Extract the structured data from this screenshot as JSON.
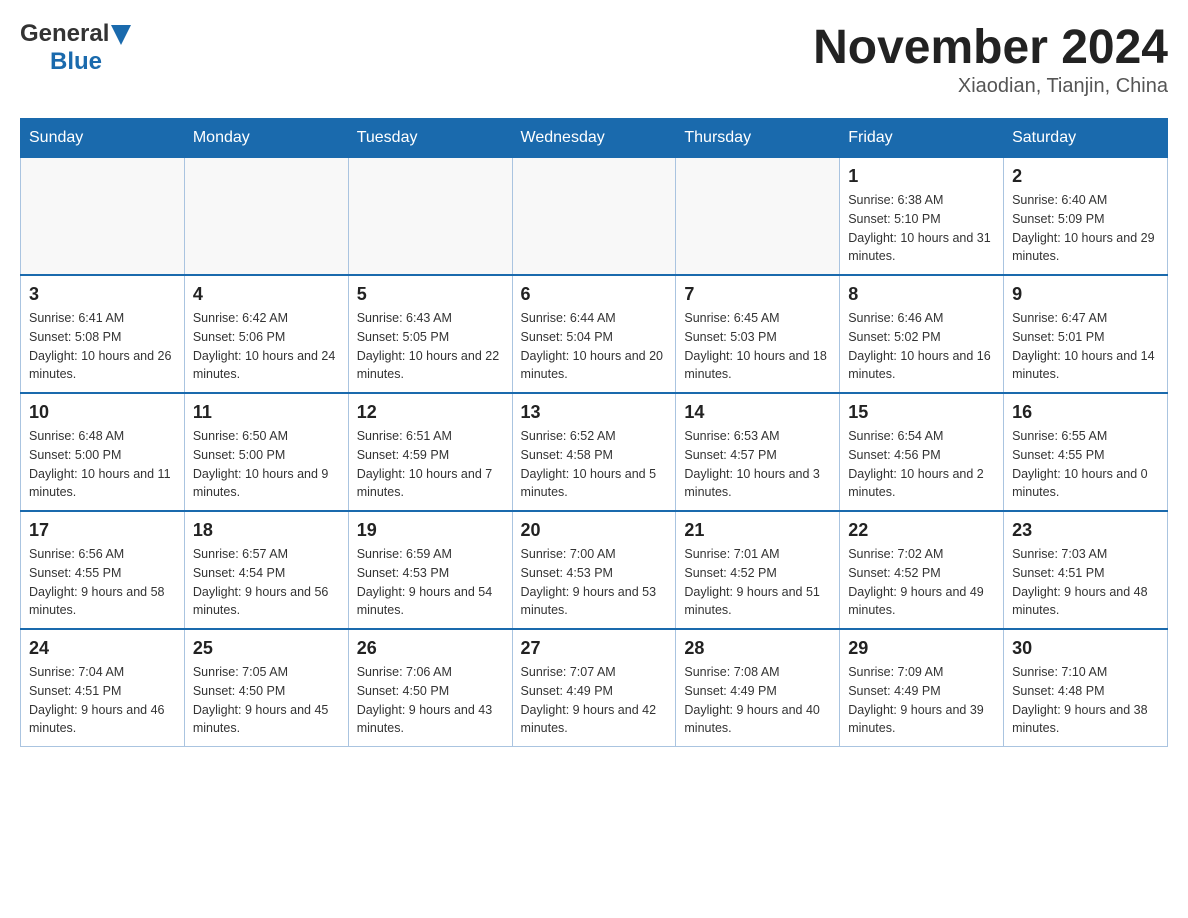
{
  "header": {
    "logo_general": "General",
    "logo_blue": "Blue",
    "title": "November 2024",
    "location": "Xiaodian, Tianjin, China"
  },
  "days_of_week": [
    "Sunday",
    "Monday",
    "Tuesday",
    "Wednesday",
    "Thursday",
    "Friday",
    "Saturday"
  ],
  "weeks": [
    [
      {
        "day": "",
        "info": ""
      },
      {
        "day": "",
        "info": ""
      },
      {
        "day": "",
        "info": ""
      },
      {
        "day": "",
        "info": ""
      },
      {
        "day": "",
        "info": ""
      },
      {
        "day": "1",
        "info": "Sunrise: 6:38 AM\nSunset: 5:10 PM\nDaylight: 10 hours and 31 minutes."
      },
      {
        "day": "2",
        "info": "Sunrise: 6:40 AM\nSunset: 5:09 PM\nDaylight: 10 hours and 29 minutes."
      }
    ],
    [
      {
        "day": "3",
        "info": "Sunrise: 6:41 AM\nSunset: 5:08 PM\nDaylight: 10 hours and 26 minutes."
      },
      {
        "day": "4",
        "info": "Sunrise: 6:42 AM\nSunset: 5:06 PM\nDaylight: 10 hours and 24 minutes."
      },
      {
        "day": "5",
        "info": "Sunrise: 6:43 AM\nSunset: 5:05 PM\nDaylight: 10 hours and 22 minutes."
      },
      {
        "day": "6",
        "info": "Sunrise: 6:44 AM\nSunset: 5:04 PM\nDaylight: 10 hours and 20 minutes."
      },
      {
        "day": "7",
        "info": "Sunrise: 6:45 AM\nSunset: 5:03 PM\nDaylight: 10 hours and 18 minutes."
      },
      {
        "day": "8",
        "info": "Sunrise: 6:46 AM\nSunset: 5:02 PM\nDaylight: 10 hours and 16 minutes."
      },
      {
        "day": "9",
        "info": "Sunrise: 6:47 AM\nSunset: 5:01 PM\nDaylight: 10 hours and 14 minutes."
      }
    ],
    [
      {
        "day": "10",
        "info": "Sunrise: 6:48 AM\nSunset: 5:00 PM\nDaylight: 10 hours and 11 minutes."
      },
      {
        "day": "11",
        "info": "Sunrise: 6:50 AM\nSunset: 5:00 PM\nDaylight: 10 hours and 9 minutes."
      },
      {
        "day": "12",
        "info": "Sunrise: 6:51 AM\nSunset: 4:59 PM\nDaylight: 10 hours and 7 minutes."
      },
      {
        "day": "13",
        "info": "Sunrise: 6:52 AM\nSunset: 4:58 PM\nDaylight: 10 hours and 5 minutes."
      },
      {
        "day": "14",
        "info": "Sunrise: 6:53 AM\nSunset: 4:57 PM\nDaylight: 10 hours and 3 minutes."
      },
      {
        "day": "15",
        "info": "Sunrise: 6:54 AM\nSunset: 4:56 PM\nDaylight: 10 hours and 2 minutes."
      },
      {
        "day": "16",
        "info": "Sunrise: 6:55 AM\nSunset: 4:55 PM\nDaylight: 10 hours and 0 minutes."
      }
    ],
    [
      {
        "day": "17",
        "info": "Sunrise: 6:56 AM\nSunset: 4:55 PM\nDaylight: 9 hours and 58 minutes."
      },
      {
        "day": "18",
        "info": "Sunrise: 6:57 AM\nSunset: 4:54 PM\nDaylight: 9 hours and 56 minutes."
      },
      {
        "day": "19",
        "info": "Sunrise: 6:59 AM\nSunset: 4:53 PM\nDaylight: 9 hours and 54 minutes."
      },
      {
        "day": "20",
        "info": "Sunrise: 7:00 AM\nSunset: 4:53 PM\nDaylight: 9 hours and 53 minutes."
      },
      {
        "day": "21",
        "info": "Sunrise: 7:01 AM\nSunset: 4:52 PM\nDaylight: 9 hours and 51 minutes."
      },
      {
        "day": "22",
        "info": "Sunrise: 7:02 AM\nSunset: 4:52 PM\nDaylight: 9 hours and 49 minutes."
      },
      {
        "day": "23",
        "info": "Sunrise: 7:03 AM\nSunset: 4:51 PM\nDaylight: 9 hours and 48 minutes."
      }
    ],
    [
      {
        "day": "24",
        "info": "Sunrise: 7:04 AM\nSunset: 4:51 PM\nDaylight: 9 hours and 46 minutes."
      },
      {
        "day": "25",
        "info": "Sunrise: 7:05 AM\nSunset: 4:50 PM\nDaylight: 9 hours and 45 minutes."
      },
      {
        "day": "26",
        "info": "Sunrise: 7:06 AM\nSunset: 4:50 PM\nDaylight: 9 hours and 43 minutes."
      },
      {
        "day": "27",
        "info": "Sunrise: 7:07 AM\nSunset: 4:49 PM\nDaylight: 9 hours and 42 minutes."
      },
      {
        "day": "28",
        "info": "Sunrise: 7:08 AM\nSunset: 4:49 PM\nDaylight: 9 hours and 40 minutes."
      },
      {
        "day": "29",
        "info": "Sunrise: 7:09 AM\nSunset: 4:49 PM\nDaylight: 9 hours and 39 minutes."
      },
      {
        "day": "30",
        "info": "Sunrise: 7:10 AM\nSunset: 4:48 PM\nDaylight: 9 hours and 38 minutes."
      }
    ]
  ]
}
